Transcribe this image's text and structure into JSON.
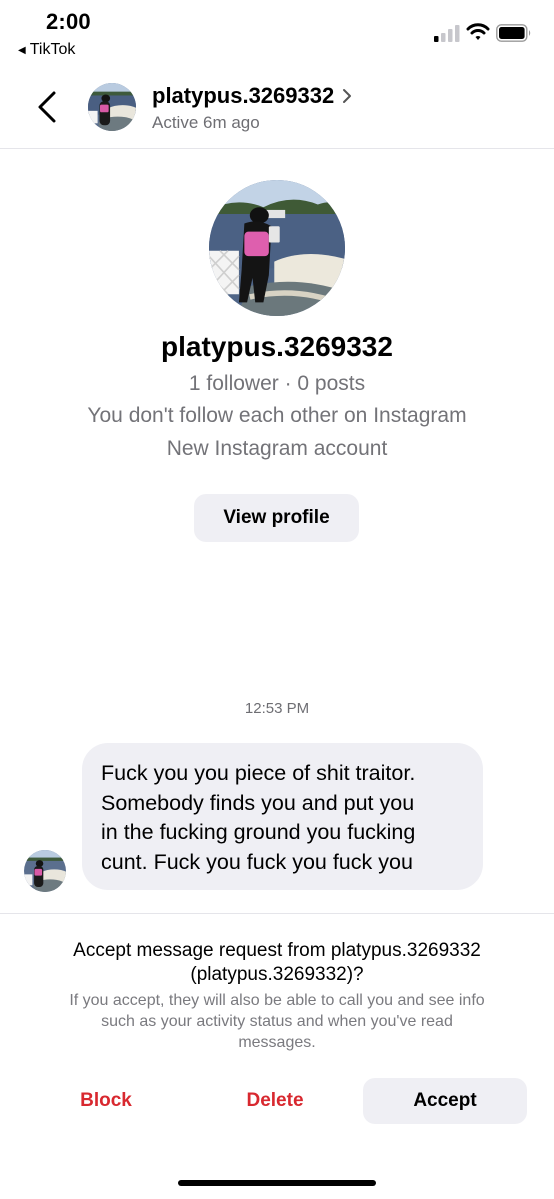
{
  "status_bar": {
    "time": "2:00",
    "back_app": "TikTok",
    "back_icon": "back-triangle-icon",
    "signal_icon": "cellular-signal-icon",
    "wifi_icon": "wifi-icon",
    "battery_icon": "battery-icon"
  },
  "header": {
    "back_icon": "chevron-left-icon",
    "username": "platypus.3269332",
    "status": "Active 6m ago",
    "chevron_icon": "chevron-right-icon"
  },
  "profile": {
    "username": "platypus.3269332",
    "stats": "1 follower · 0 posts",
    "relationship": "You don't follow each other on Instagram",
    "account_note": "New Instagram account",
    "view_profile_label": "View profile"
  },
  "conversation": {
    "timestamp": "12:53 PM",
    "message_lines": [
      "Fuck you you piece of shit traitor.",
      "Somebody finds you and put you",
      "in the fucking ground you fucking",
      "cunt. Fuck you fuck you fuck you"
    ]
  },
  "request": {
    "title_line1": "Accept message request from platypus.3269332",
    "title_line2": "(platypus.3269332)?",
    "desc_line1": "If you accept, they will also be able to call you and see info",
    "desc_line2": "such as your activity status and when you've read",
    "desc_line3": "messages.",
    "block_label": "Block",
    "delete_label": "Delete",
    "accept_label": "Accept"
  },
  "colors": {
    "destructive": "#d8282f",
    "secondary_text": "#737378",
    "bubble_bg": "#efeff4"
  }
}
